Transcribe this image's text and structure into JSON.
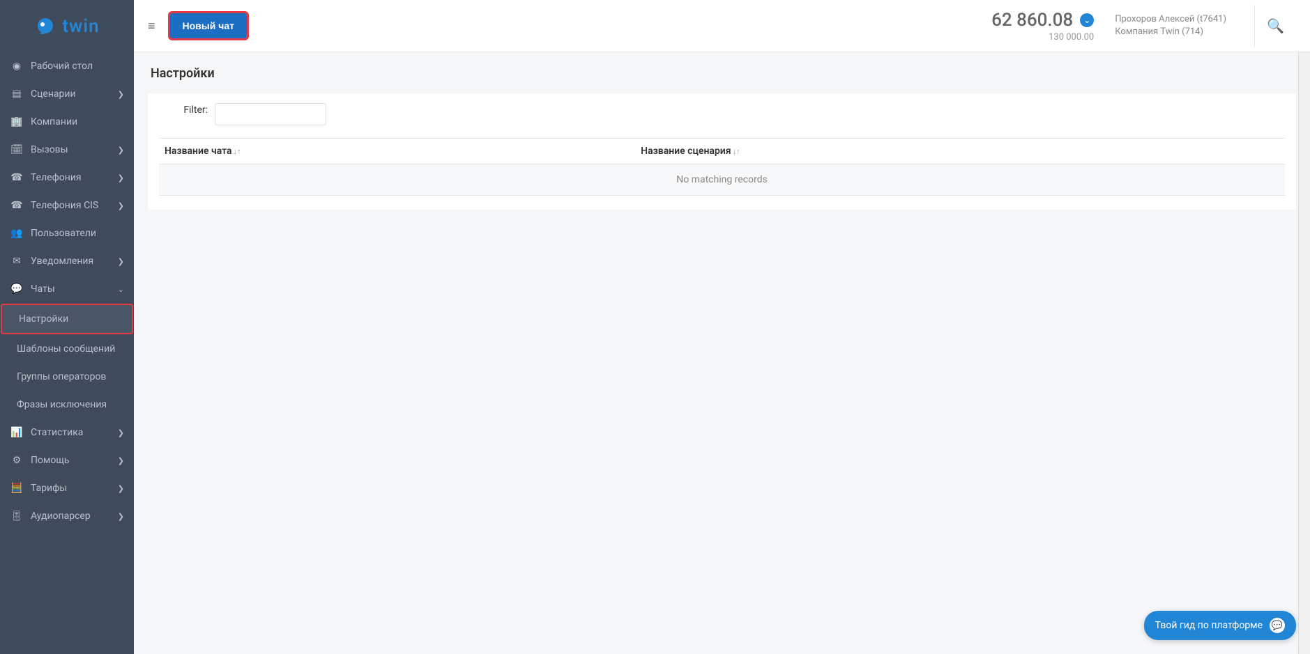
{
  "brand": "twin",
  "sidebar": {
    "items": [
      {
        "label": "Рабочий стол",
        "icon": "dashboard",
        "chev": false
      },
      {
        "label": "Сценарии",
        "icon": "scenarios",
        "chev": true
      },
      {
        "label": "Компании",
        "icon": "company",
        "chev": false
      },
      {
        "label": "Вызовы",
        "icon": "calls",
        "chev": true
      },
      {
        "label": "Телефония",
        "icon": "telephony",
        "chev": true
      },
      {
        "label": "Телефония CIS",
        "icon": "telephony-cis",
        "chev": true
      },
      {
        "label": "Пользователи",
        "icon": "users",
        "chev": false
      },
      {
        "label": "Уведомления",
        "icon": "notifications",
        "chev": true
      },
      {
        "label": "Чаты",
        "icon": "chats",
        "chev": true,
        "expanded": true
      },
      {
        "label": "Статистика",
        "icon": "stats",
        "chev": true
      },
      {
        "label": "Помощь",
        "icon": "help",
        "chev": true
      },
      {
        "label": "Тарифы",
        "icon": "tariffs",
        "chev": true
      },
      {
        "label": "Аудиопарсер",
        "icon": "audio",
        "chev": true
      }
    ],
    "chats_sub": [
      {
        "label": "Настройки",
        "active": true
      },
      {
        "label": "Шаблоны сообщений",
        "active": false
      },
      {
        "label": "Группы операторов",
        "active": false
      },
      {
        "label": "Фразы исключения",
        "active": false
      }
    ]
  },
  "header": {
    "new_chat": "Новый чат",
    "balance": "62 860.08",
    "balance_sub": "130 000.00",
    "user_line1": "Прохоров Алексей (t7641)",
    "user_line2": "Компания Twin (714)"
  },
  "page": {
    "title": "Настройки",
    "filter_label": "Filter:",
    "col1": "Название чата",
    "col2": "Название сценария",
    "empty": "No matching records"
  },
  "guide": "Твой гид по платформе"
}
